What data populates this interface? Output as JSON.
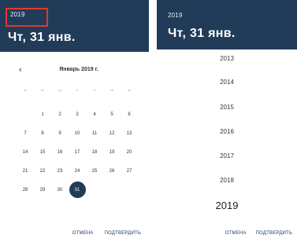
{
  "left_panel": {
    "header": {
      "year": "2019",
      "date": "Чт, 31 янв."
    },
    "calendar": {
      "prev_arrow": "‹",
      "month_title": "Январь 2019 г.",
      "weekdays": [
        "пн",
        "вт",
        "ср",
        "чт",
        "пт",
        "сб",
        "вс"
      ],
      "days": [
        "",
        "1",
        "2",
        "3",
        "4",
        "5",
        "6",
        "7",
        "8",
        "9",
        "10",
        "11",
        "12",
        "13",
        "14",
        "15",
        "16",
        "17",
        "18",
        "19",
        "20",
        "21",
        "22",
        "23",
        "24",
        "25",
        "26",
        "27",
        "28",
        "29",
        "30",
        "31"
      ],
      "selected_day": "31"
    },
    "actions": {
      "cancel": "ОТМЕНА",
      "confirm": "ПОДТВЕРДИТЬ"
    }
  },
  "right_panel": {
    "header": {
      "year": "2019",
      "date": "Чт, 31 янв."
    },
    "years": [
      "2013",
      "2014",
      "2015",
      "2016",
      "2017",
      "2018",
      "2019"
    ],
    "selected_year": "2019",
    "actions": {
      "cancel": "ОТМЕНА",
      "confirm": "ПОДТВЕРДИТЬ"
    }
  },
  "colors": {
    "header_bg": "#213c58",
    "highlight": "#e0392a",
    "accent": "#213c58"
  },
  "icons": {
    "prev_month": "chevron-left-icon"
  }
}
